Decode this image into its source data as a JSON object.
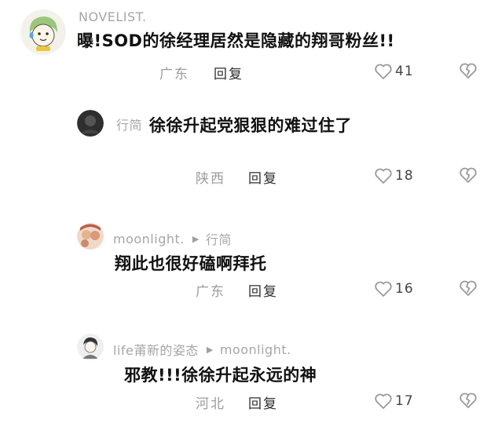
{
  "comments": [
    {
      "author": "NOVELIST.",
      "text": "曝!SOD的徐经理居然是隐藏的翔哥粉丝!!",
      "location": "广东",
      "reply_label": "回复",
      "likes": "41"
    },
    {
      "author": "行简",
      "text": "徐徐升起党狠狠的难过住了",
      "location": "陕西",
      "reply_label": "回复",
      "likes": "18"
    },
    {
      "author": "moonlight.",
      "reply_to": "行简",
      "text": "翔此也很好磕啊拜托",
      "location": "广东",
      "reply_label": "回复",
      "likes": "16"
    },
    {
      "author": "life莆新的姿态",
      "reply_to": "moonlight.",
      "text": "邪教!!!徐徐升起永远的神",
      "location": "河北",
      "reply_label": "回复",
      "likes": "17"
    }
  ],
  "icons": {
    "like": "heart-outline-icon",
    "dislike": "broken-heart-icon",
    "reply_arrow": "triangle-right-icon"
  },
  "colors": {
    "text": "#111111",
    "meta": "#a6a6a6",
    "icon": "#9a9a9a"
  }
}
